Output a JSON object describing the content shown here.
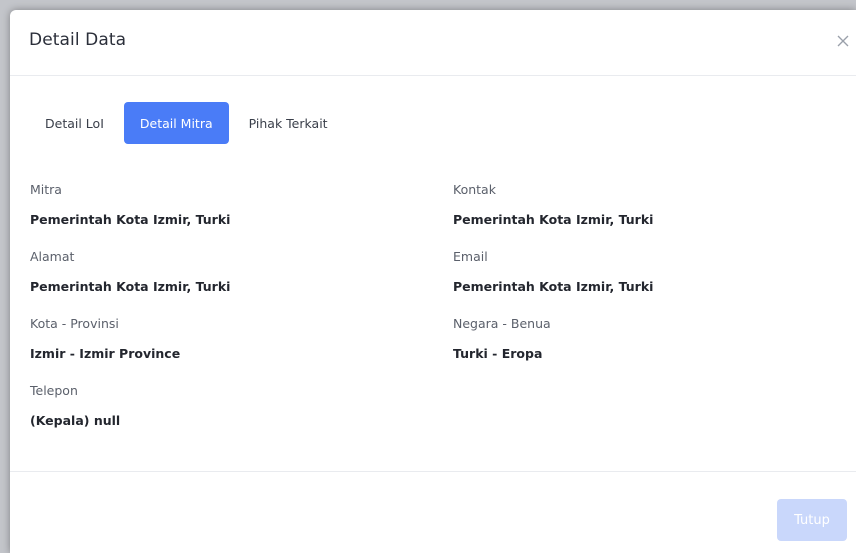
{
  "modal": {
    "title": "Detail Data"
  },
  "tabs": [
    {
      "label": "Detail LoI",
      "active": false
    },
    {
      "label": "Detail Mitra",
      "active": true
    },
    {
      "label": "Pihak Terkait",
      "active": false
    }
  ],
  "fields": {
    "mitra": {
      "label": "Mitra",
      "value": "Pemerintah Kota Izmir, Turki"
    },
    "kontak": {
      "label": "Kontak",
      "value": "Pemerintah Kota Izmir, Turki"
    },
    "alamat": {
      "label": "Alamat",
      "value": "Pemerintah Kota Izmir, Turki"
    },
    "email": {
      "label": "Email",
      "value": "Pemerintah Kota Izmir, Turki"
    },
    "kota_provinsi": {
      "label": "Kota - Provinsi",
      "value": "Izmir - Izmir Province"
    },
    "negara_benua": {
      "label": "Negara - Benua",
      "value": "Turki - Eropa"
    },
    "telepon": {
      "label": "Telepon",
      "value": "(Kepala) null"
    }
  },
  "footer": {
    "close_label": "Tutup"
  },
  "icons": {
    "close": "close-icon"
  },
  "colors": {
    "accent": "#4a7cf7",
    "button_disabled": "#c9d7fb"
  }
}
